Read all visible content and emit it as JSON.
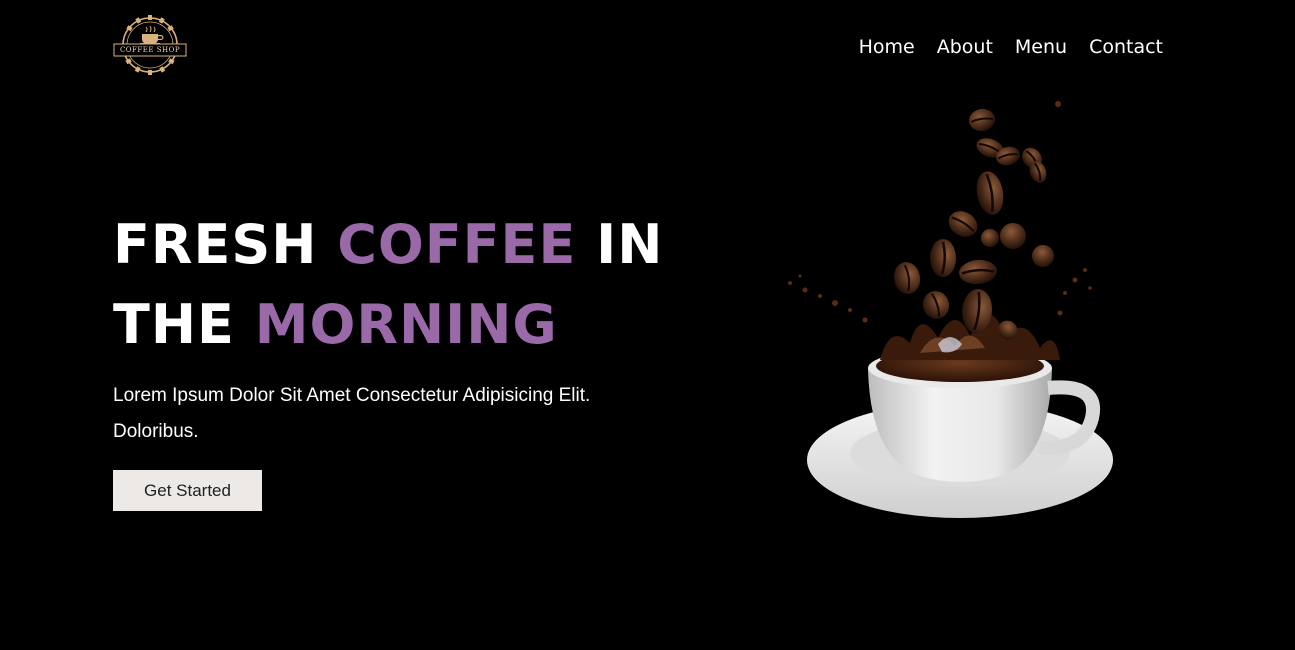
{
  "brand": {
    "logo_text": "COFFEE SHOP",
    "logo_color": "#d9b27c"
  },
  "nav": {
    "items": [
      {
        "label": "Home"
      },
      {
        "label": "About"
      },
      {
        "label": "Menu"
      },
      {
        "label": "Contact"
      }
    ]
  },
  "hero": {
    "title_line1_part1": "FRESH ",
    "title_line1_accent": "COFFEE",
    "title_line1_part2": " IN",
    "title_line2_part1": "THE ",
    "title_line2_accent": "MORNING",
    "description": "Lorem Ipsum Dolor Sit Amet Consectetur Adipisicing Elit. Doloribus.",
    "cta_label": "Get Started",
    "accent_color": "#9a69a8",
    "image_icon": "coffee-cup-with-falling-beans"
  },
  "colors": {
    "background": "#000000",
    "text": "#ffffff",
    "button_bg": "#ece9e6"
  }
}
